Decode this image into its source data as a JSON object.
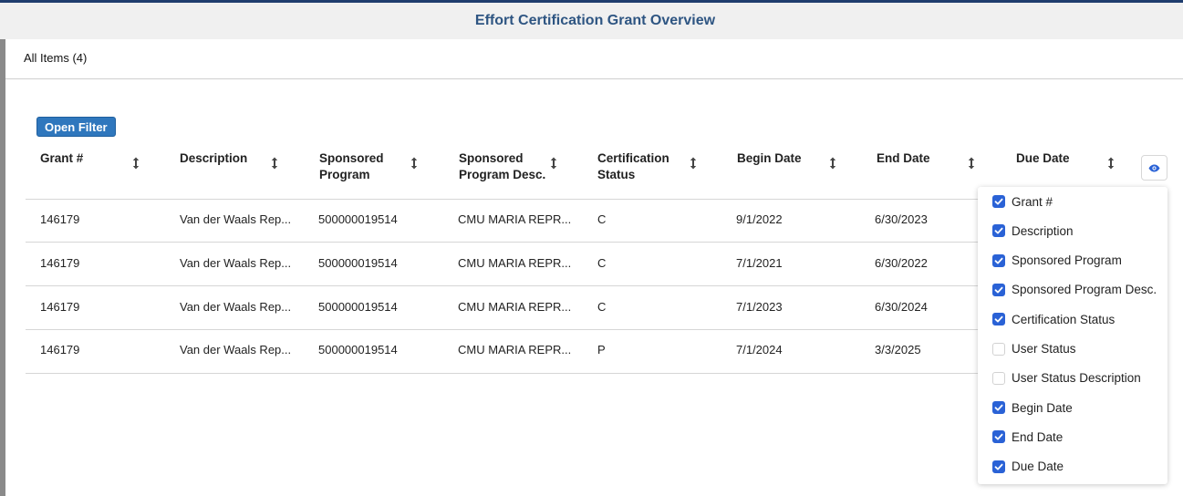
{
  "header": {
    "title": "Effort Certification Grant Overview"
  },
  "tabs": {
    "all_items": "All Items (4)"
  },
  "toolbar": {
    "open_filter": "Open Filter"
  },
  "columns": [
    {
      "key": "grant",
      "line1": "Grant #",
      "line2": ""
    },
    {
      "key": "description",
      "line1": "Description",
      "line2": ""
    },
    {
      "key": "sponsored_program",
      "line1": "Sponsored",
      "line2": "Program"
    },
    {
      "key": "sponsored_program_desc",
      "line1": "Sponsored",
      "line2": "Program Desc."
    },
    {
      "key": "certification_status",
      "line1": "Certification",
      "line2": "Status"
    },
    {
      "key": "begin_date",
      "line1": "Begin Date",
      "line2": ""
    },
    {
      "key": "end_date",
      "line1": "End Date",
      "line2": ""
    },
    {
      "key": "due_date",
      "line1": "Due Date",
      "line2": ""
    }
  ],
  "rows": [
    {
      "grant": "146179",
      "description": "Van der Waals Rep...",
      "sponsored_program": "500000019514",
      "sponsored_program_desc": "CMU MARIA REPR...",
      "certification_status": "C",
      "begin_date": "9/1/2022",
      "end_date": "6/30/2023"
    },
    {
      "grant": "146179",
      "description": "Van der Waals Rep...",
      "sponsored_program": "500000019514",
      "sponsored_program_desc": "CMU MARIA REPR...",
      "certification_status": "C",
      "begin_date": "7/1/2021",
      "end_date": "6/30/2022"
    },
    {
      "grant": "146179",
      "description": "Van der Waals Rep...",
      "sponsored_program": "500000019514",
      "sponsored_program_desc": "CMU MARIA REPR...",
      "certification_status": "C",
      "begin_date": "7/1/2023",
      "end_date": "6/30/2024"
    },
    {
      "grant": "146179",
      "description": "Van der Waals Rep...",
      "sponsored_program": "500000019514",
      "sponsored_program_desc": "CMU MARIA REPR...",
      "certification_status": "P",
      "begin_date": "7/1/2024",
      "end_date": "3/3/2025"
    }
  ],
  "column_chooser": {
    "icon": "eye-icon",
    "items": [
      {
        "label": "Grant #",
        "checked": true
      },
      {
        "label": "Description",
        "checked": true
      },
      {
        "label": "Sponsored Program",
        "checked": true
      },
      {
        "label": "Sponsored Program Desc.",
        "checked": true
      },
      {
        "label": "Certification Status",
        "checked": true
      },
      {
        "label": "User Status",
        "checked": false
      },
      {
        "label": "User Status Description",
        "checked": false
      },
      {
        "label": "Begin Date",
        "checked": true
      },
      {
        "label": "End Date",
        "checked": true
      },
      {
        "label": "Due Date",
        "checked": true
      }
    ]
  },
  "colors": {
    "accent": "#2a62d6",
    "header_title": "#2e5582",
    "filter_button": "#2f77bd",
    "top_border": "#1f3d6e"
  }
}
